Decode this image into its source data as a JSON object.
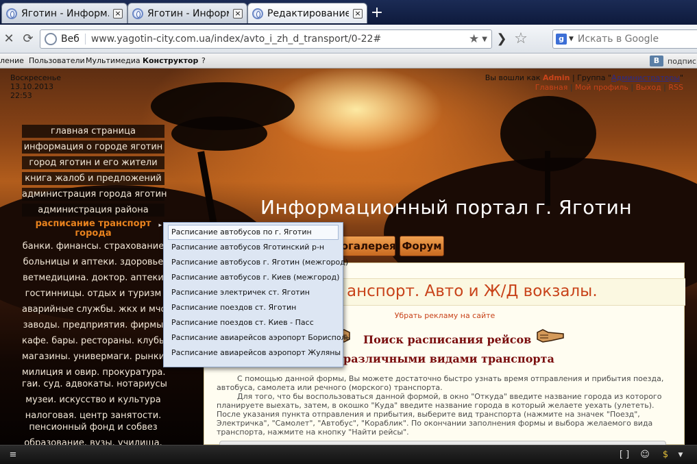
{
  "browser": {
    "tabs": [
      {
        "title": "Яготин - Информ...",
        "active": false
      },
      {
        "title": "Яготин - Информ...",
        "active": false
      },
      {
        "title": "Редактирование ...",
        "active": true
      }
    ],
    "new_tab": "+",
    "address": {
      "label": "Веб",
      "url": "www.yagotin-city.com.ua/index/avto_i_zh_d_transport/0-22#"
    },
    "search_placeholder": "Искать в Google",
    "search_engine_letter": "g"
  },
  "adminbar": {
    "items": [
      "ление",
      "Пользователи",
      "Мультимедиа",
      "Конструктор",
      "?"
    ],
    "vk_letter": "В",
    "vk_text": "подпис"
  },
  "site": {
    "day": "Воскресенье",
    "date": "13.10.2013",
    "time": "22:53",
    "login_prefix": "Вы вошли как",
    "login_user": "Admin",
    "group_prefix": "| Группа \"",
    "group_name": "Администраторы",
    "group_suffix": "\"",
    "links": [
      "Главная",
      "Мой профиль",
      "Выход",
      "RSS"
    ],
    "portal_title": "Информационный портал г. Яготин",
    "top_buttons": [
      "тогалерея",
      "Форум"
    ],
    "side_menu": [
      "главная страница",
      "информация о городе яготин",
      "город яготин и его жители",
      "книга жалоб и предложений",
      "администрация города яготин",
      "администрация района",
      "расписание транспорт города",
      "банки. финансы. страхование",
      "больницы и аптеки. здоровье",
      "ветмедицина. доктор. аптеки",
      "гостинницы. отдых и туризм",
      "аварийные службы. жкх и мчс",
      "заводы. предприятия. фирмы",
      "кафе. бары. рестораны. клубы",
      "магазины. универмаги. рынки",
      "милиция и овир. прокуратура.",
      "гаи. суд. адвокаты. нотариусы",
      "музеи. искусство и культура",
      "налоговая. центр занятости.",
      "пенсионный фонд и собвез",
      "образование. вузы. училища."
    ],
    "submenu": [
      "Расписание автобусов по г. Яготин",
      "Расписание автобусов Яготинский р-н",
      "Расписание автобусов г. Яготин (межгород)",
      "Расписание автобусов г. Киев (межгород)",
      "Расписание электричек ст. Яготин",
      "Расписание поездов ст. Яготин",
      "Расписание поездов ст. Киев - Пасс",
      "Расписание авиарейсов аэропорт Борисполь",
      "Расписание авиарейсов аэропорт Жуляны"
    ],
    "content": {
      "heading": "анспорт. Авто и Ж/Д вокзалы.",
      "remove_ads": "Убрать рекламу на сайте",
      "search_title_1": "Поиск расписания рейсов",
      "search_title_2": "различными видами транспорта",
      "paragraph_1": "С помощью данной формы, Вы можете достаточно быстро узнать время отправления и прибытия поезда, автобуса, самолета или речного (морского) транспорта.",
      "paragraph_2": "Для того, что бы воспользоваться данной формой, в окно \"Откуда\" введите название города из которого планируете выехать, затем, в окошко \"Куда\" введите название города в который желаете уехать (улететь). После указания пункта отправления и прибытия, выберите вид транспорта (нажмите на значек \"Поезд\", Электричка\", \"Самолет\", \"Автобус\", \"Кораблик\". По окончании заполнения формы и выбора желаемого вида транспорта, нажмите на кнопку \"Найти рейсы\"."
    }
  },
  "colors": {
    "accent_orange": "#c8431a",
    "menu_highlight": "#e8821e",
    "submenu_bg": "#dde6f3"
  }
}
